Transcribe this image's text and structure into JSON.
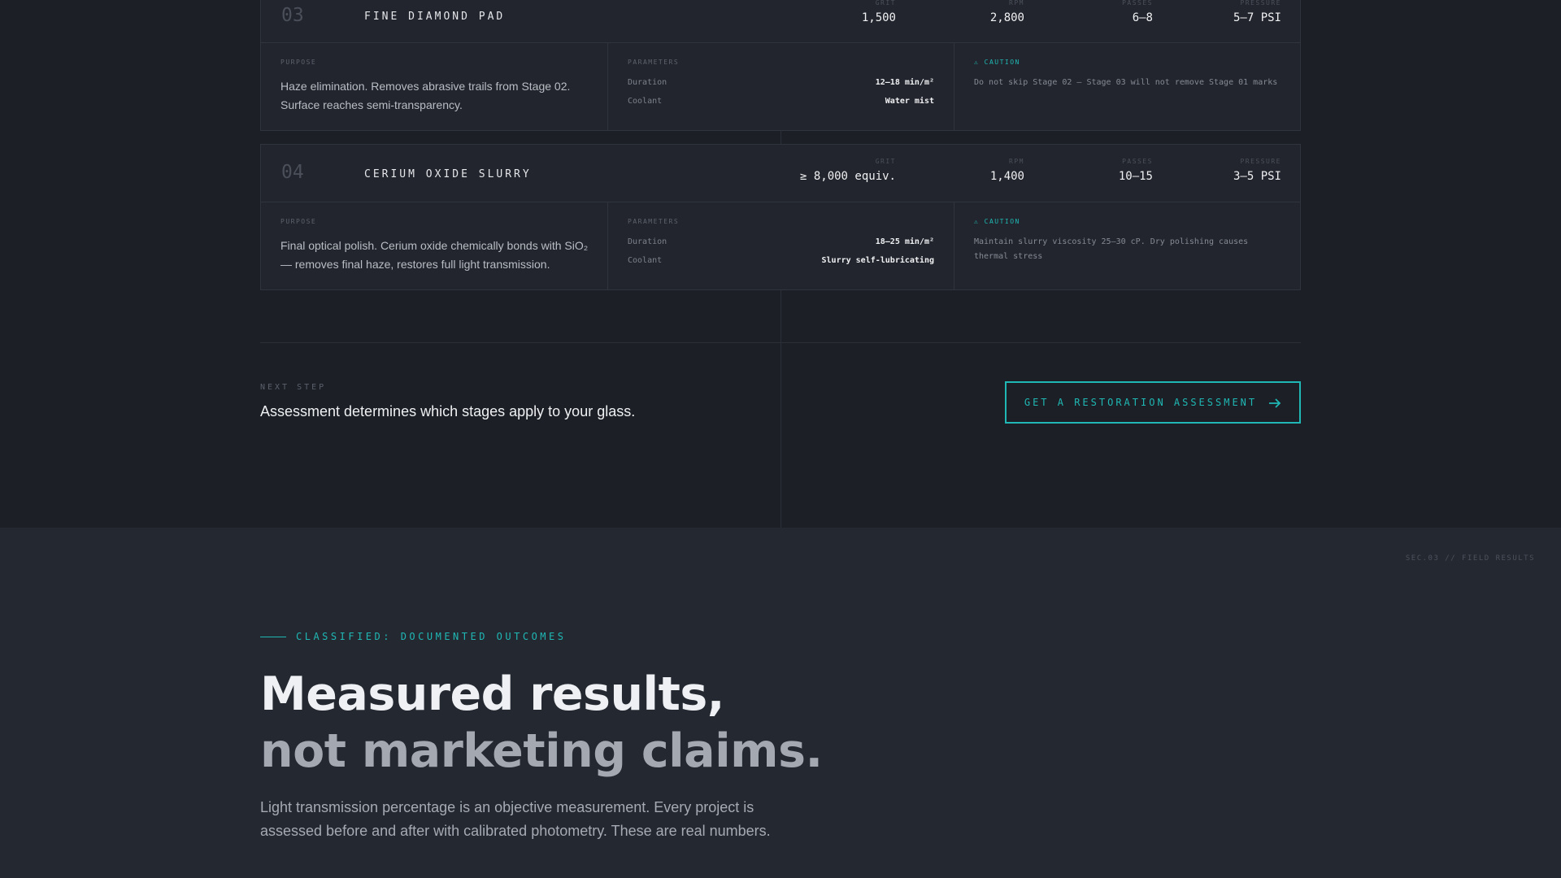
{
  "stages": [
    {
      "number": "03",
      "name": "FINE DIAMOND PAD",
      "stats": {
        "grit": {
          "label": "GRIT",
          "value": "1,500"
        },
        "rpm": {
          "label": "RPM",
          "value": "2,800"
        },
        "passes": {
          "label": "PASSES",
          "value": "6–8"
        },
        "pressure": {
          "label": "PRESSURE",
          "value": "5–7 PSI"
        }
      },
      "purpose_label": "PURPOSE",
      "purpose": "Haze elimination. Removes abrasive trails from Stage 02. Surface reaches semi-transparency.",
      "parameters_label": "PARAMETERS",
      "duration_key": "Duration",
      "duration": "12–18 min/m²",
      "coolant_key": "Coolant",
      "coolant": "Water mist",
      "caution_label": "⚠ CAUTION",
      "caution": "Do not skip Stage 02 — Stage 03 will not remove Stage 01 marks"
    },
    {
      "number": "04",
      "name": "CERIUM OXIDE SLURRY",
      "stats": {
        "grit": {
          "label": "GRIT",
          "value": "≥ 8,000 equiv."
        },
        "rpm": {
          "label": "RPM",
          "value": "1,400"
        },
        "passes": {
          "label": "PASSES",
          "value": "10–15"
        },
        "pressure": {
          "label": "PRESSURE",
          "value": "3–5 PSI"
        }
      },
      "purpose_label": "PURPOSE",
      "purpose": "Final optical polish. Cerium oxide chemically bonds with SiO₂ — removes final haze, restores full light transmission.",
      "parameters_label": "PARAMETERS",
      "duration_key": "Duration",
      "duration": "18–25 min/m²",
      "coolant_key": "Coolant",
      "coolant": "Slurry self-lubricating",
      "caution_label": "⚠ CAUTION",
      "caution": "Maintain slurry viscosity 25–30 cP. Dry polishing causes thermal stress"
    }
  ],
  "next_step": {
    "label": "NEXT STEP",
    "text": "Assessment determines which stages apply to your glass.",
    "cta_label": "GET A RESTORATION ASSESSMENT",
    "cta_icon": "arrow-right-icon"
  },
  "results_section": {
    "tag": "SEC.03 // FIELD RESULTS",
    "eyebrow": "CLASSIFIED: DOCUMENTED OUTCOMES",
    "headline_line1": "Measured results,",
    "headline_line2": "not marketing claims.",
    "lede": "Light transmission percentage is an objective measurement. Every project is assessed before and after with calibrated photometry. These are real numbers."
  },
  "colors": {
    "accent": "#1fb8b4",
    "background_top": "#1c1f26",
    "background_bottom": "#242831",
    "card": "#22252d"
  }
}
